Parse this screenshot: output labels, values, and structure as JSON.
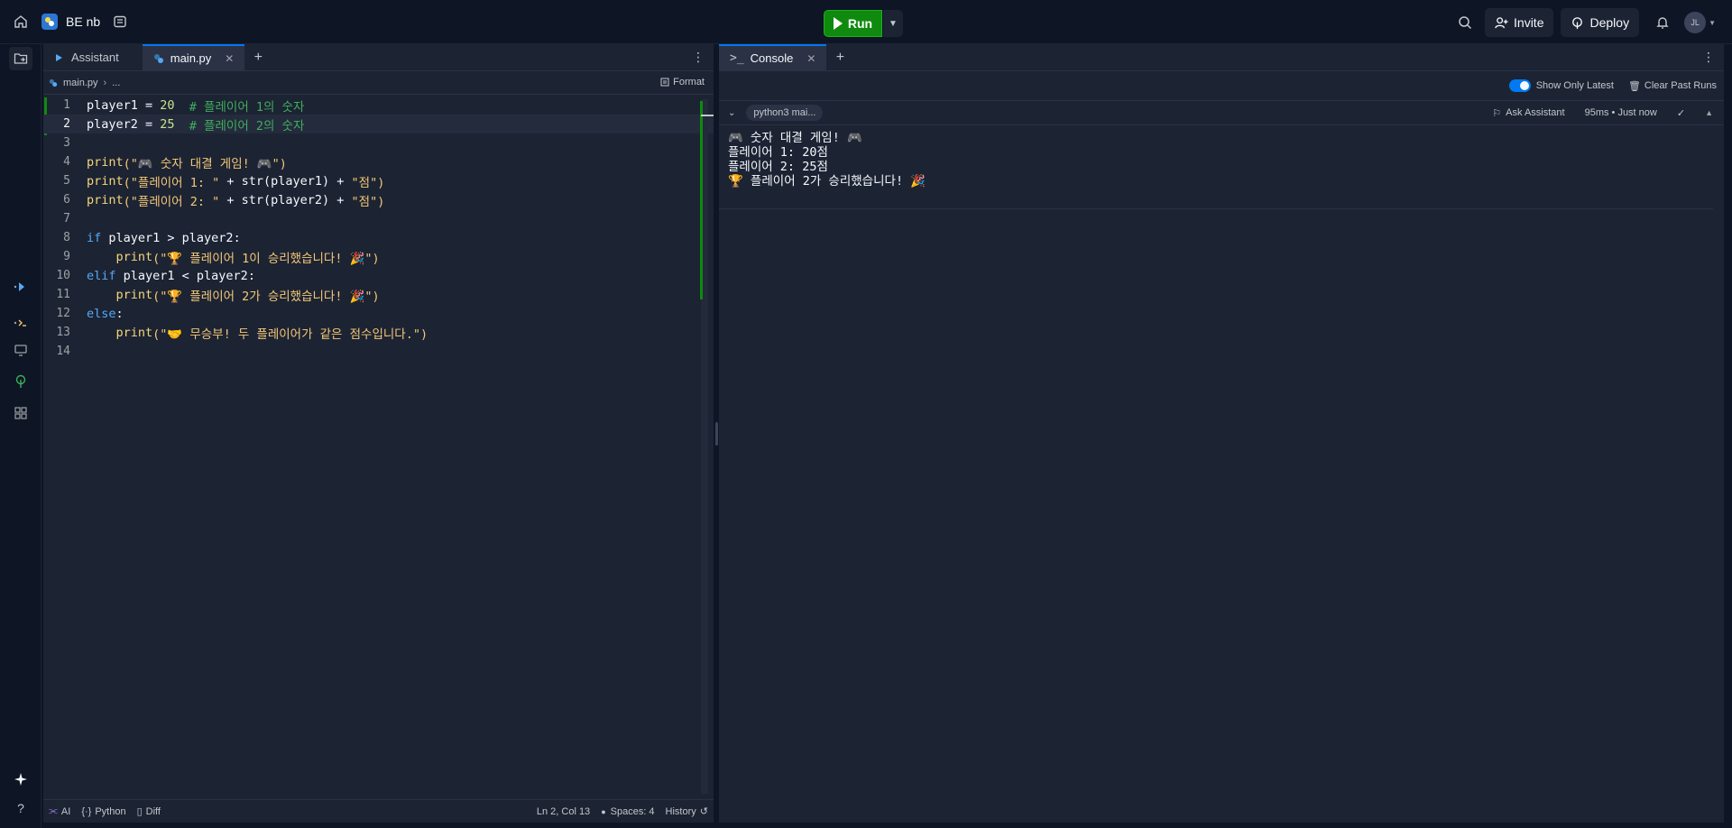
{
  "topbar": {
    "repl_name": "BE nb",
    "run_label": "Run",
    "invite_label": "Invite",
    "deploy_label": "Deploy",
    "avatar_initials": "JL"
  },
  "editor": {
    "tabs": [
      {
        "label": "Assistant"
      },
      {
        "label": "main.py"
      }
    ],
    "breadcrumb_file": "main.py",
    "breadcrumb_more": "...",
    "format_label": "Format",
    "lines": [
      {
        "n": "1"
      },
      {
        "n": "2"
      },
      {
        "n": "3"
      },
      {
        "n": "4"
      },
      {
        "n": "5"
      },
      {
        "n": "6"
      },
      {
        "n": "7"
      },
      {
        "n": "8"
      },
      {
        "n": "9"
      },
      {
        "n": "10"
      },
      {
        "n": "11"
      },
      {
        "n": "12"
      },
      {
        "n": "13"
      },
      {
        "n": "14"
      }
    ],
    "code": {
      "l1_a": "player1 = ",
      "l1_num": "20",
      "l1_cm": "  # 플레이어 1의 숫자",
      "l2_a": "player2 = ",
      "l2_num": "25",
      "l2_cm": "  # 플레이어 2의 숫자",
      "l4_fn": "print",
      "l4_str": "(\"🎮 숫자 대결 게임! 🎮\")",
      "l5_fn": "print",
      "l5_str": "(\"플레이어 1: \"",
      "l5_b": " + str(player1) + ",
      "l5_str2": "\"점\")",
      "l6_fn": "print",
      "l6_str": "(\"플레이어 2: \"",
      "l6_b": " + str(player2) + ",
      "l6_str2": "\"점\")",
      "l8_kw": "if",
      "l8_b": " player1 > player2:",
      "l9_fn": "    print",
      "l9_str": "(\"🏆 플레이어 1이 승리했습니다! 🎉\")",
      "l10_kw": "elif",
      "l10_b": " player1 < player2:",
      "l11_fn": "    print",
      "l11_str": "(\"🏆 플레이어 2가 승리했습니다! 🎉\")",
      "l12_kw": "else",
      "l12_b": ":",
      "l13_fn": "    print",
      "l13_str": "(\"🤝 무승부! 두 플레이어가 같은 점수입니다.\")"
    },
    "status": {
      "ai": "AI",
      "language": "Python",
      "diff": "Diff",
      "cursor": "Ln 2, Col 13",
      "spaces": "Spaces: 4",
      "history": "History"
    }
  },
  "console": {
    "tab_label": "Console",
    "show_only_latest": "Show Only Latest",
    "clear_past_runs": "Clear Past Runs",
    "run_chip": "python3 mai...",
    "ask_assistant": "Ask Assistant",
    "run_meta": "95ms • Just now",
    "output": [
      "🎮 숫자 대결 게임! 🎮",
      "플레이어 1: 20점",
      "플레이어 2: 25점",
      "🏆 플레이어 2가 승리했습니다! 🎉"
    ]
  }
}
